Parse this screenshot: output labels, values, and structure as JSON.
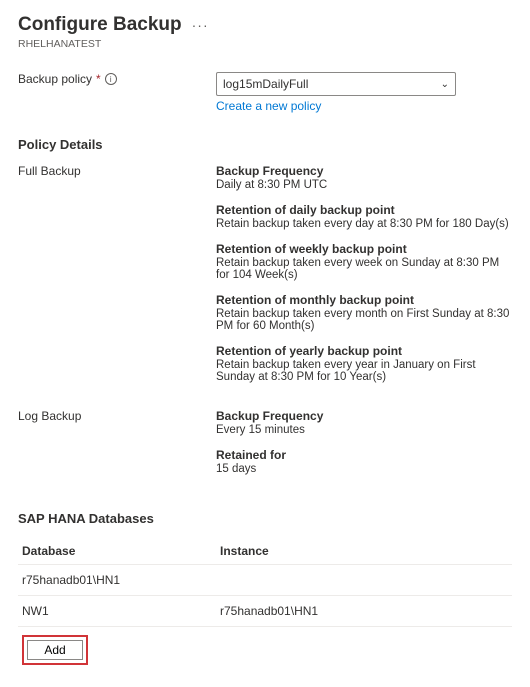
{
  "header": {
    "title": "Configure Backup",
    "subtitle": "RHELHANATEST"
  },
  "policy_select": {
    "label": "Backup policy",
    "value": "log15mDailyFull",
    "create_link": "Create a new policy"
  },
  "policy_details": {
    "heading": "Policy Details",
    "full_backup_label": "Full Backup",
    "log_backup_label": "Log Backup",
    "full": {
      "freq_title": "Backup Frequency",
      "freq_text": "Daily at 8:30 PM UTC",
      "daily_title": "Retention of daily backup point",
      "daily_text": "Retain backup taken every day at 8:30 PM for 180 Day(s)",
      "weekly_title": "Retention of weekly backup point",
      "weekly_text": "Retain backup taken every week on Sunday at 8:30 PM for 104 Week(s)",
      "monthly_title": "Retention of monthly backup point",
      "monthly_text": "Retain backup taken every month on First Sunday at 8:30 PM for 60 Month(s)",
      "yearly_title": "Retention of yearly backup point",
      "yearly_text": "Retain backup taken every year in January on First Sunday at 8:30 PM for 10 Year(s)"
    },
    "log": {
      "freq_title": "Backup Frequency",
      "freq_text": "Every 15 minutes",
      "ret_title": "Retained for",
      "ret_text": "15 days"
    }
  },
  "databases": {
    "heading": "SAP HANA Databases",
    "col_db": "Database",
    "col_inst": "Instance",
    "rows": [
      {
        "db": "r75hanadb01\\HN1",
        "inst": ""
      },
      {
        "db": "NW1",
        "inst": "r75hanadb01\\HN1"
      }
    ],
    "add_label": "Add"
  }
}
